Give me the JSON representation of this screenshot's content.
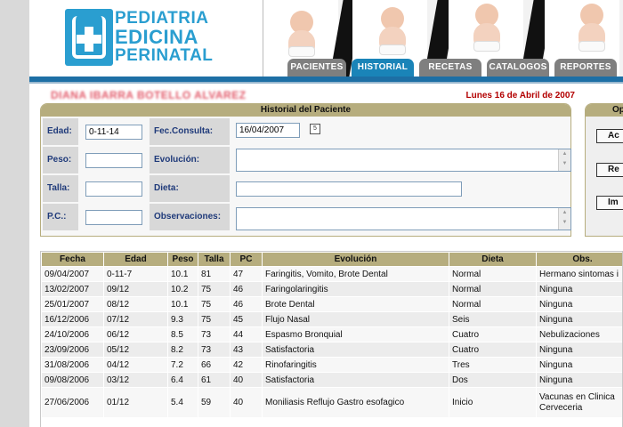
{
  "logo": {
    "line1": "PEDIATRIA",
    "line2": "EDICINA",
    "line3": "PERINATAL"
  },
  "tabs": [
    {
      "label": "PACIENTES",
      "active": false
    },
    {
      "label": "HISTORIAL",
      "active": true
    },
    {
      "label": "RECETAS",
      "active": false
    },
    {
      "label": "CATALOGOS",
      "active": false
    },
    {
      "label": "REPORTES",
      "active": false
    }
  ],
  "patient": {
    "name": "DIANA IBARRA BOTELLO ALVAREZ"
  },
  "date_text": "Lunes 16 de Abril de 2007",
  "form": {
    "title": "Historial del Paciente",
    "edad": {
      "label": "Edad:",
      "value": "0-11-14"
    },
    "peso": {
      "label": "Peso:",
      "value": ""
    },
    "talla": {
      "label": "Talla:",
      "value": ""
    },
    "pc": {
      "label": "P.C.:",
      "value": ""
    },
    "fec_consulta": {
      "label": "Fec.Consulta:",
      "value": "16/04/2007"
    },
    "evolucion": {
      "label": "Evolución:",
      "value": ""
    },
    "dieta": {
      "label": "Dieta:",
      "value": ""
    },
    "observaciones": {
      "label": "Observaciones:",
      "value": ""
    }
  },
  "options": {
    "title": "Op",
    "buttons": [
      "Ac",
      "Re",
      "Im"
    ]
  },
  "table": {
    "columns": [
      "Fecha",
      "Edad",
      "Peso",
      "Talla",
      "PC",
      "Evolución",
      "Dieta",
      "Obs."
    ],
    "rows": [
      [
        "09/04/2007",
        "0-11-7",
        "10.1",
        "81",
        "47",
        "Faringitis, Vomito, Brote Dental",
        "Normal",
        "Hermano sintomas i"
      ],
      [
        "13/02/2007",
        "09/12",
        "10.2",
        "75",
        "46",
        "Faringolaringitis",
        "Normal",
        "Ninguna"
      ],
      [
        "25/01/2007",
        "08/12",
        "10.1",
        "75",
        "46",
        "Brote Dental",
        "Normal",
        "Ninguna"
      ],
      [
        "16/12/2006",
        "07/12",
        "9.3",
        "75",
        "45",
        "Flujo Nasal",
        "Seis",
        "Ninguna"
      ],
      [
        "24/10/2006",
        "06/12",
        "8.5",
        "73",
        "44",
        "Espasmo Bronquial",
        "Cuatro",
        "Nebulizaciones"
      ],
      [
        "23/09/2006",
        "05/12",
        "8.2",
        "73",
        "43",
        "Satisfactoria",
        "Cuatro",
        "Ninguna"
      ],
      [
        "31/08/2006",
        "04/12",
        "7.2",
        "66",
        "42",
        "Rinofaringitis",
        "Tres",
        "Ninguna"
      ],
      [
        "09/08/2006",
        "03/12",
        "6.4",
        "61",
        "40",
        "Satisfactoria",
        "Dos",
        "Ninguna"
      ],
      [
        "27/06/2006",
        "01/12",
        "5.4",
        "59",
        "40",
        "Moniliasis Reflujo Gastro esofagico",
        "Inicio",
        "Vacunas en Clinica Cerveceria"
      ]
    ]
  }
}
